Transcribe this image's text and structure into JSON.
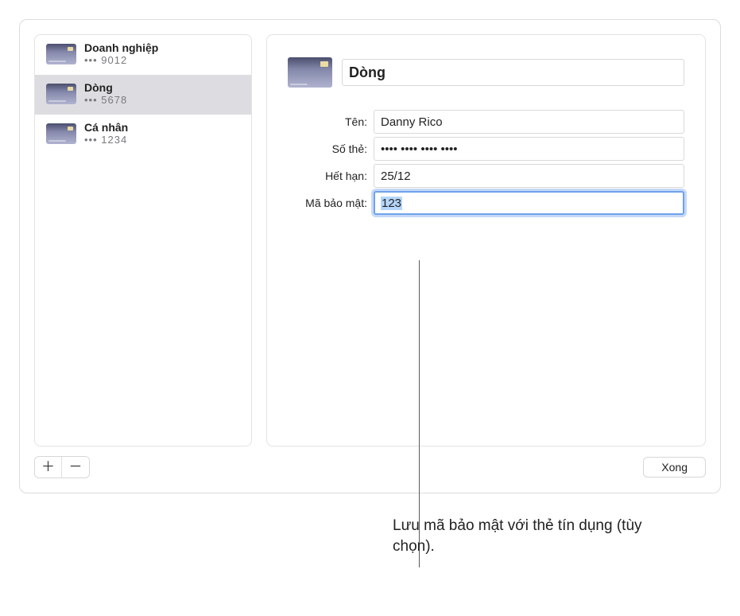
{
  "sidebar": {
    "items": [
      {
        "title": "Doanh nghiệp",
        "number": "••• 9012"
      },
      {
        "title": "Dòng",
        "number": "••• 5678"
      },
      {
        "title": "Cá nhân",
        "number": "••• 1234"
      }
    ]
  },
  "detail": {
    "title_value": "Dòng",
    "labels": {
      "name": "Tên:",
      "card": "Số thẻ:",
      "exp": "Hết hạn:",
      "cvv": "Mã bảo mật:"
    },
    "values": {
      "name": "Danny Rico",
      "card": "•••• •••• •••• ••••",
      "exp": "25/12",
      "cvv": "123"
    }
  },
  "controls": {
    "plus": "＋",
    "minus": "－",
    "done": "Xong"
  },
  "callout": "Lưu mã bảo mật với thẻ tín dụng (tùy chọn)."
}
